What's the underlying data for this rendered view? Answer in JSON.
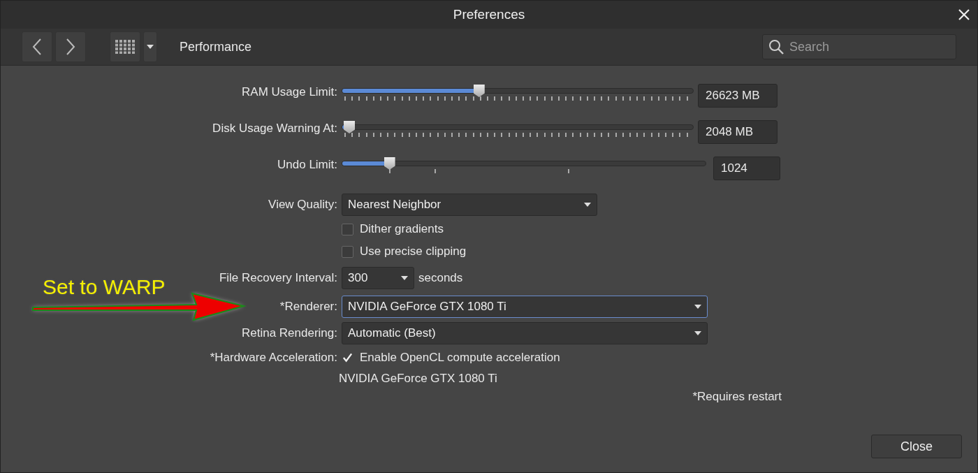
{
  "window": {
    "title": "Preferences"
  },
  "toolbar": {
    "page_title": "Performance",
    "search": {
      "placeholder": "Search"
    }
  },
  "settings": [
    {
      "kind": "slider",
      "label": "RAM Usage Limit:",
      "level": 0.39,
      "value": "26623 MB"
    },
    {
      "kind": "slider",
      "label": "Disk Usage Warning At:",
      "level": 0.02,
      "value": "2048 MB"
    },
    {
      "kind": "stepslider",
      "label": "Undo Limit:",
      "level": 0.13,
      "value": "1024"
    },
    {
      "kind": "select",
      "label": "View Quality:",
      "value": "Nearest Neighbor",
      "focused": false
    },
    {
      "kind": "checkbox",
      "text": "Dither gradients",
      "checked": false
    },
    {
      "kind": "checkbox",
      "text": "Use precise clipping",
      "checked": false
    },
    {
      "kind": "combo",
      "label": "File Recovery Interval:",
      "value": "300",
      "suffix": "seconds"
    },
    {
      "kind": "dropdown",
      "label": "*Renderer:",
      "value": "NVIDIA GeForce GTX 1080 Ti",
      "focused": true
    },
    {
      "kind": "dropdown",
      "label": "Retina Rendering:",
      "value": "Automatic (Best)",
      "focused": false
    },
    {
      "kind": "checkbox",
      "label": "*Hardware Acceleration:",
      "text": "Enable OpenCL compute acceleration",
      "checked": true
    },
    {
      "kind": "note",
      "text": "NVIDIA GeForce GTX 1080 Ti"
    }
  ],
  "footnote": "*Requires restart",
  "annotation": {
    "text": "Set to WARP"
  },
  "buttons": [
    "Close"
  ]
}
